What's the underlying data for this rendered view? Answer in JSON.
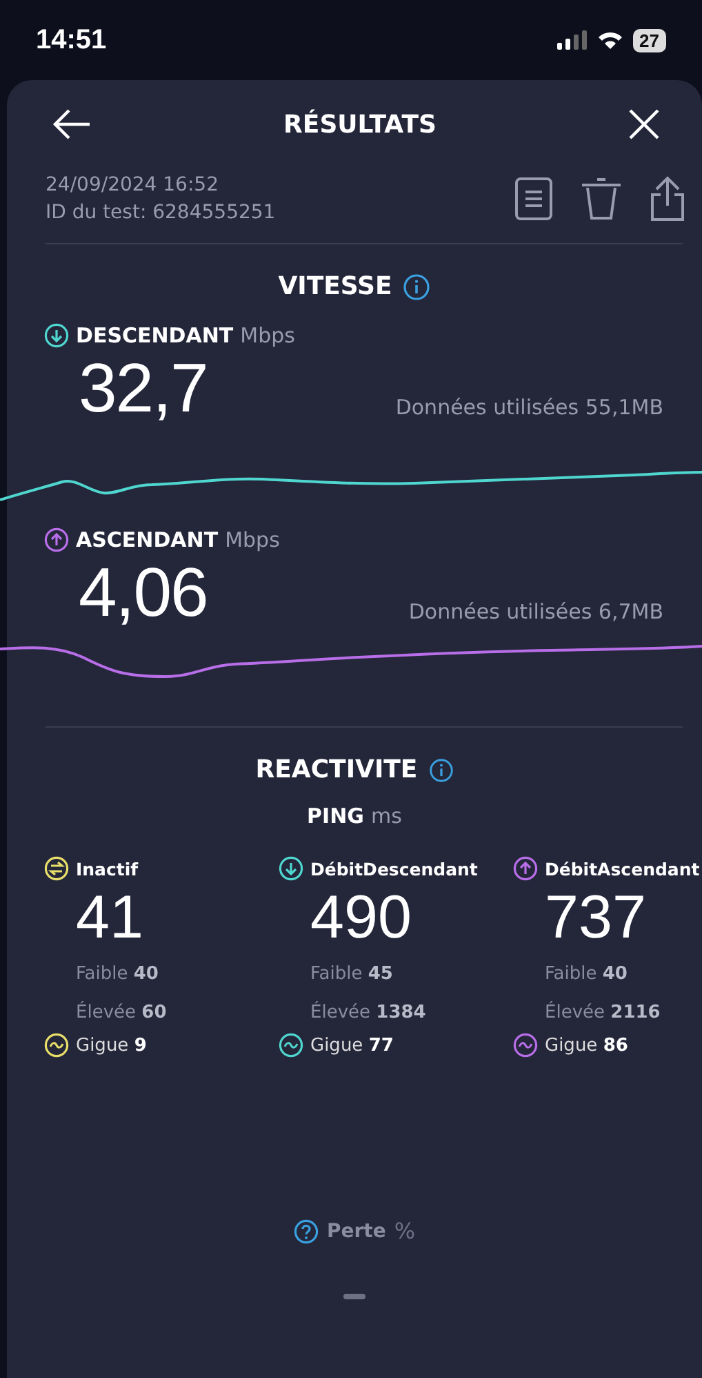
{
  "status_bar": {
    "time": "14:51",
    "battery": "27"
  },
  "header": {
    "title": "RÉSULTATS"
  },
  "test": {
    "date": "24/09/2024 16:52",
    "id": "ID du test: 6284555251"
  },
  "speed": {
    "title": "VITESSE",
    "sections": [
      {
        "kind": "down",
        "color": "#4fd6cf",
        "label": "DESCENDANT",
        "unit": "Mbps",
        "value": "32,7",
        "data": "Données utilisées 55,1MB"
      },
      {
        "kind": "up",
        "color": "#b86ee8",
        "label": "ASCENDANT",
        "unit": "Mbps",
        "value": "4,06",
        "data": "Données utilisées 6,7MB"
      }
    ]
  },
  "responsiveness": {
    "title": "REACTIVITE",
    "ping_label": "PING",
    "ping_unit": "ms",
    "columns": [
      {
        "kind": "idle",
        "color": "#e8df6a",
        "label": "Inactif",
        "value": "41",
        "low": "Faible **40**",
        "high": "Élevée **60**",
        "jitter": "Gigue **9**"
      },
      {
        "kind": "down",
        "color": "#4fd6cf",
        "label": "DébitDescendant",
        "value": "490",
        "low": "Faible **45**",
        "high": "Élevée **1384**",
        "jitter": "Gigue **77**"
      },
      {
        "kind": "up",
        "color": "#b86ee8",
        "label": "DébitAscendant",
        "value": "737",
        "low": "Faible **40**",
        "high": "Élevée **2116**",
        "jitter": "Gigue **86**"
      }
    ],
    "loss": {
      "label": "Perte",
      "unit": "%"
    }
  }
}
